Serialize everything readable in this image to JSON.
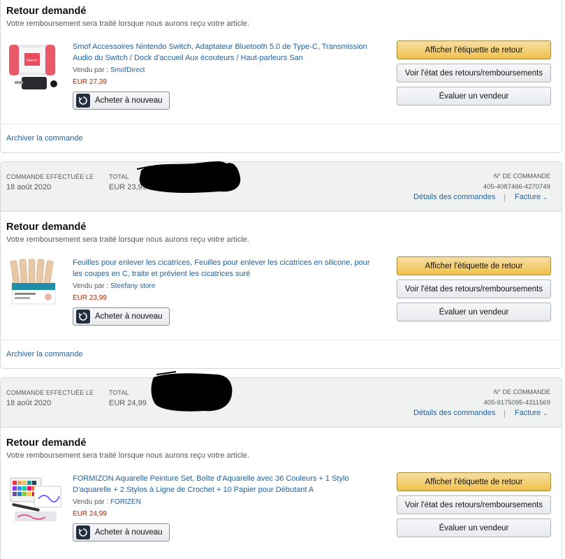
{
  "orders": [
    {
      "status": "Retour demandé",
      "refund_note": "Votre remboursement sera traité lorsque nous aurons reçu votre article.",
      "product_title": "Smof Accessoires Nintendo Switch, Adaptateur Bluetooth 5.0 de Type-C, Transmission Audio du Switch / Dock d'accueil Aux écouteurs / Haut-parleurs San",
      "sold_by_label": "Vendu par :",
      "seller": "SmofDirect",
      "price": "EUR 27,39",
      "buy_again": "Acheter à nouveau",
      "btn_label": "Afficher l'étiquette de retour",
      "btn_status": "Voir l'état des retours/remboursements",
      "btn_rate": "Évaluer un vendeur",
      "archive": "Archiver la commande"
    },
    {
      "header": {
        "placed_label": "COMMANDE EFFECTUÉE LE",
        "placed_date": "18 août 2020",
        "total_label": "TOTAL",
        "total_value": "EUR 23,99",
        "order_label": "N° DE COMMANDE",
        "order_number": "405-4087466-4270749",
        "details": "Détails des commandes",
        "invoice": "Facture"
      },
      "status": "Retour demandé",
      "refund_note": "Votre remboursement sera traité lorsque nous aurons reçu votre article.",
      "product_title": "Feuilles pour enlever les cicatrices, Feuilles pour enlever les cicatrices en silicone, pour les coupes en C, traite et prévient les cicatrices suré",
      "sold_by_label": "Vendu par :",
      "seller": "Steefany store",
      "price": "EUR 23,99",
      "buy_again": "Acheter à nouveau",
      "btn_label": "Afficher l'étiquette de retour",
      "btn_status": "Voir l'état des retours/remboursements",
      "btn_rate": "Évaluer un vendeur",
      "archive": "Archiver la commande"
    },
    {
      "header": {
        "placed_label": "COMMANDE EFFECTUÉE LE",
        "placed_date": "18 août 2020",
        "total_label": "TOTAL",
        "total_value": "EUR 24,99",
        "order_label": "N° DE COMMANDE",
        "order_number": "405-9175095-4311569",
        "details": "Détails des commandes",
        "invoice": "Facture"
      },
      "status": "Retour demandé",
      "refund_note": "Votre remboursement sera traité lorsque nous aurons reçu votre article.",
      "product_title": "FORMIZON Aquarelle Peinture Set, Boîte d'Aquarelle avec 36 Couleurs + 1 Stylo D'aquarelle + 2 Stylos à Ligne de Crochet + 10 Papier pour Débutant A",
      "sold_by_label": "Vendu par :",
      "seller": "FORIZEN",
      "price": "EUR 24,99",
      "buy_again": "Acheter à nouveau",
      "btn_label": "Afficher l'étiquette de retour",
      "btn_status": "Voir l'état des retours/remboursements",
      "btn_rate": "Évaluer un vendeur"
    }
  ]
}
